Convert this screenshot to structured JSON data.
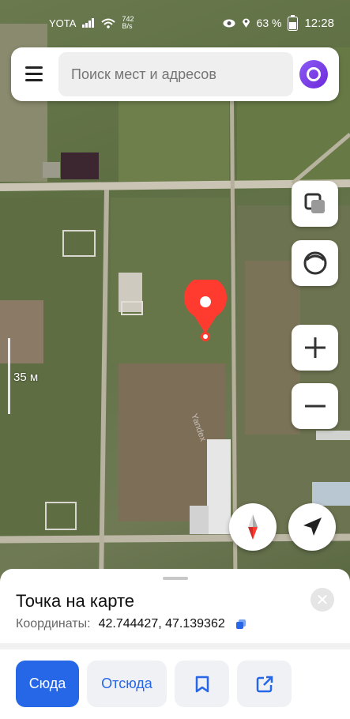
{
  "status_bar": {
    "carrier": "YOTA",
    "speed_value": "742",
    "speed_unit": "B/s",
    "battery": "63 %",
    "time": "12:28"
  },
  "search": {
    "placeholder": "Поиск мест и адресов"
  },
  "map": {
    "scale_label": "35 м",
    "watermark": "Yandex"
  },
  "place": {
    "title": "Точка на карте",
    "coords_label": "Координаты:",
    "coords_value": "42.744427, 47.139362"
  },
  "actions": {
    "here": "Сюда",
    "from": "Отсюда"
  },
  "colors": {
    "accent": "#2667e8",
    "pin": "#ff3b30",
    "alice": "#7c3aed"
  },
  "icons": [
    "menu-icon",
    "alice-icon",
    "layers-icon",
    "route-icon",
    "zoom-in-icon",
    "zoom-out-icon",
    "compass-icon",
    "location-arrow-icon",
    "copy-icon",
    "close-icon",
    "bookmark-icon",
    "share-icon"
  ]
}
